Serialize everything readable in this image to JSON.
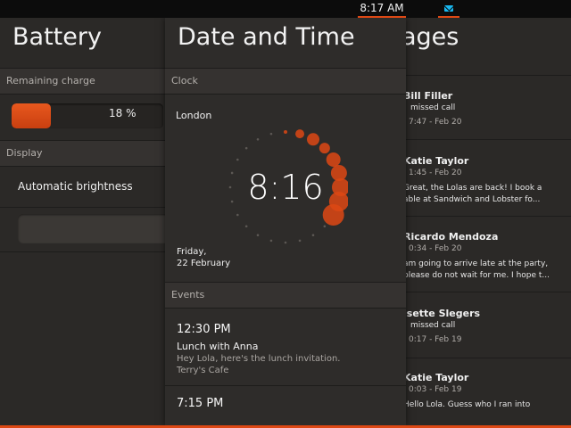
{
  "status_bar": {
    "time": "8:17 AM",
    "message_icon": "envelope-icon"
  },
  "battery": {
    "title": "Battery",
    "remaining_header": "Remaining charge",
    "charge_label": "18 %",
    "charge_fraction": 0.18,
    "display_header": "Display",
    "auto_brightness_label": "Automatic brightness"
  },
  "datetime": {
    "title": "Date and Time",
    "clock_header": "Clock",
    "city": "London",
    "time": "8:16",
    "day": "Friday,",
    "date": "22 February",
    "events_header": "Events",
    "events": [
      {
        "time": "12:30 PM",
        "title": "Lunch with Anna",
        "desc1": "Hey Lola, here's the lunch invitation.",
        "desc2": "Terry's Cafe"
      },
      {
        "time": "7:15 PM",
        "title": "",
        "desc1": "",
        "desc2": ""
      }
    ]
  },
  "messages": {
    "title": "ages",
    "items": [
      {
        "name": "Bill Filler",
        "line": "missed call",
        "time": "7:47 - Feb 20",
        "body1": "",
        "body2": ""
      },
      {
        "name": "Katie Taylor",
        "line": "",
        "time": "1:45 - Feb 20",
        "body1": "Great, the Lolas are back! I book a",
        "body2": "able at Sandwich and Lobster fo..."
      },
      {
        "name": "Ricardo Mendoza",
        "line": "",
        "time": "0:34 - Feb 20",
        "body1": "am going to arrive late at the party,",
        "body2": "please do not wait for me. I hope t..."
      },
      {
        "name": "isette Slegers",
        "line": "missed call",
        "time": "0:17 - Feb 19",
        "body1": "",
        "body2": ""
      },
      {
        "name": "Katie Taylor",
        "line": "",
        "time": "0:03 - Feb 19",
        "body1": "Hello Lola. Guess who I ran into",
        "body2": ""
      }
    ]
  },
  "colors": {
    "accent": "#dd4814",
    "background": "#2b2927",
    "indicator_blue": "#19b6ee"
  }
}
